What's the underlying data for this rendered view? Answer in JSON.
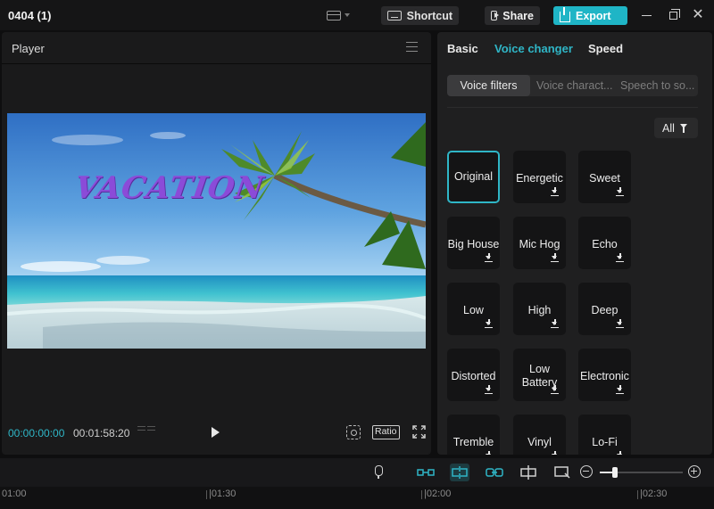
{
  "titlebar": {
    "title": "0404 (1)",
    "shortcut_label": "Shortcut",
    "share_label": "Share",
    "export_label": "Export",
    "close_glyph": "✕"
  },
  "player": {
    "title": "Player",
    "overlay_text": "VACATION",
    "current_time": "00:00:00:00",
    "total_time": "00:01:58:20",
    "ratio_label": "Ratio"
  },
  "right_panel": {
    "tabs": [
      {
        "label": "Basic",
        "active": false
      },
      {
        "label": "Voice changer",
        "active": true
      },
      {
        "label": "Speed",
        "active": false
      }
    ],
    "subtabs": [
      {
        "label": "Voice filters",
        "active": true
      },
      {
        "label": "Voice charact...",
        "active": false
      },
      {
        "label": "Speech to so...",
        "active": false
      }
    ],
    "filter_label": "All",
    "cards": [
      {
        "label": "Original",
        "selected": true,
        "download": false
      },
      {
        "label": "Energetic",
        "selected": false,
        "download": true
      },
      {
        "label": "Sweet",
        "selected": false,
        "download": true
      },
      {
        "label": "Big House",
        "selected": false,
        "download": true
      },
      {
        "label": "Mic Hog",
        "selected": false,
        "download": true
      },
      {
        "label": "Echo",
        "selected": false,
        "download": true
      },
      {
        "label": "Low",
        "selected": false,
        "download": true
      },
      {
        "label": "High",
        "selected": false,
        "download": true
      },
      {
        "label": "Deep",
        "selected": false,
        "download": true
      },
      {
        "label": "Distorted",
        "selected": false,
        "download": true
      },
      {
        "label": "Low Battery",
        "selected": false,
        "download": true
      },
      {
        "label": "Electronic",
        "selected": false,
        "download": true
      },
      {
        "label": "Tremble",
        "selected": false,
        "download": true
      },
      {
        "label": "Vinyl",
        "selected": false,
        "download": true
      },
      {
        "label": "Lo-Fi",
        "selected": false,
        "download": true
      }
    ]
  },
  "timeline": {
    "ruler_labels": [
      "01:00",
      "|01:30",
      "|02:00",
      "|02:30"
    ]
  },
  "colors": {
    "accent": "#2fb6c7",
    "export_button": "#1fb5c6",
    "overlay_text": "#8b4bd8"
  }
}
